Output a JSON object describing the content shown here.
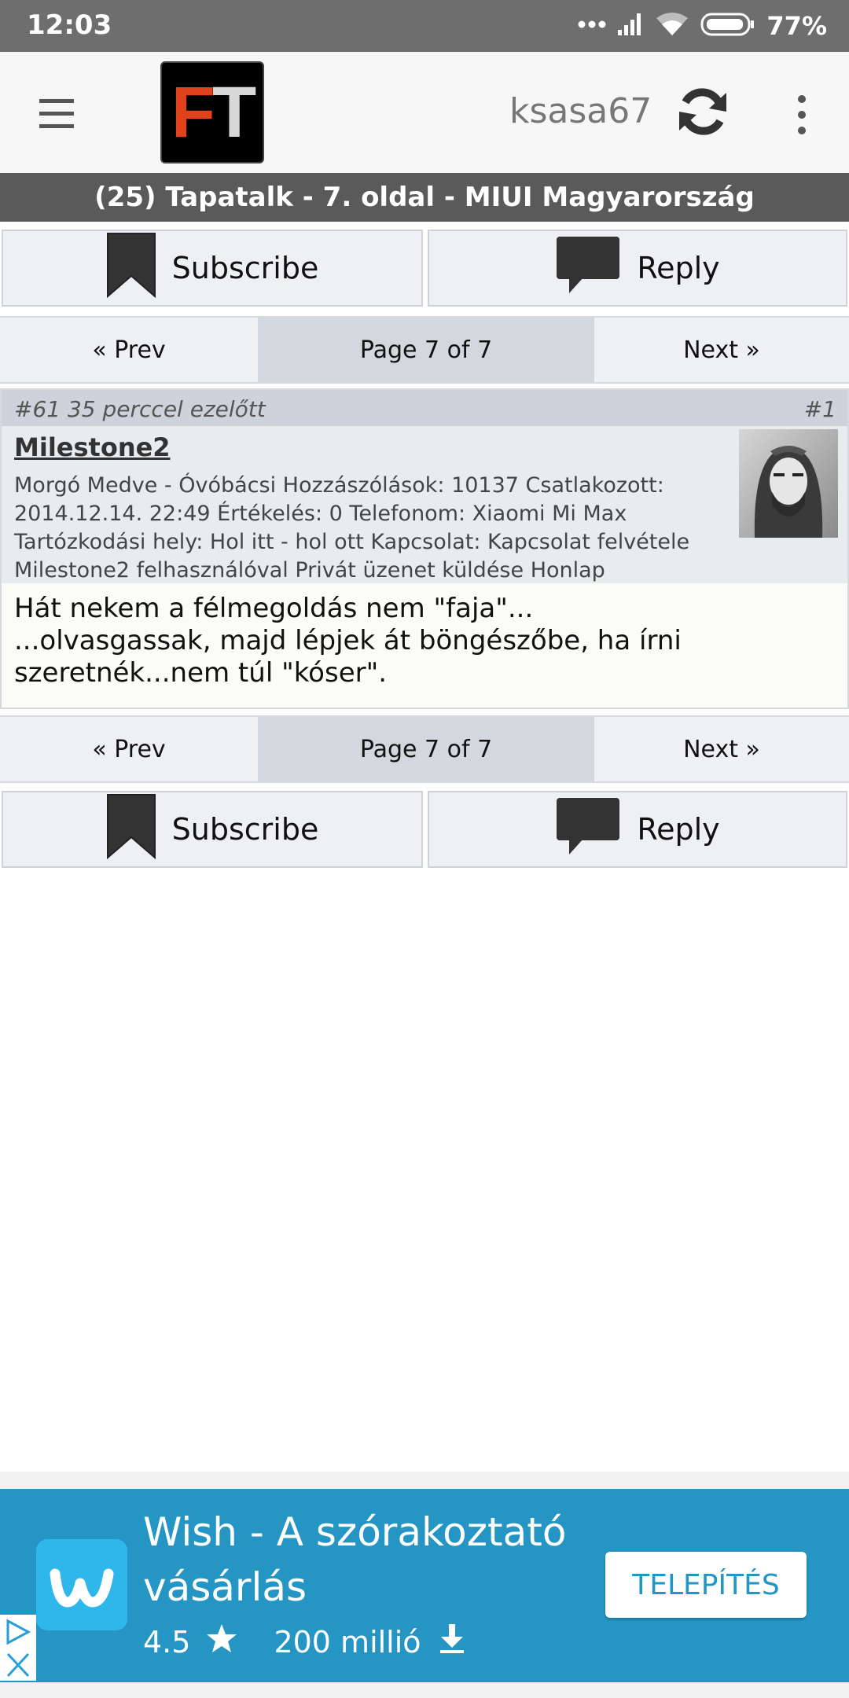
{
  "status_bar": {
    "time": "12:03",
    "battery": "77%"
  },
  "app_bar": {
    "logo_text_f": "F",
    "logo_text_t": "T",
    "username": "ksasa67"
  },
  "title_bar": {
    "title": "(25) Tapatalk - 7. oldal - MIUI Magyarország"
  },
  "actions": {
    "subscribe": "Subscribe",
    "reply": "Reply"
  },
  "pagination": {
    "prev": "« Prev",
    "current": "Page 7 of 7",
    "next": "Next »"
  },
  "post": {
    "meta": "#61 35 perccel ezelőtt",
    "number": "#1",
    "author": "Milestone2",
    "user_info": "Morgó Medve - Óvóbácsi Hozzászólások: 10137 Csatlakozott: 2014.12.14. 22:49 Értékelés: 0 Telefonom: Xiaomi Mi Max Tartózkodási hely: Hol itt - hol ott Kapcsolat: Kapcsolat felvétele Milestone2 felhasználóval Privát üzenet küldése Honlap",
    "body": "Hát nekem a félmegoldás nem \"faja\"...\n...olvasgassak, majd lépjek át böngészőbe, ha írni szeretnék...nem túl \"kóser\"."
  },
  "ad": {
    "title": "Wish - A szórakoztató vásárlás",
    "rating": "4.5",
    "downloads": "200 millió",
    "install_label": "TELEPÍTÉS",
    "colors": {
      "background": "#2596c4",
      "icon_bg": "#2fb7ec"
    }
  },
  "colors": {
    "title_bar": "#5a5a5a",
    "logo_f": "#e0431b",
    "status_bar": "#6e6e6e"
  }
}
